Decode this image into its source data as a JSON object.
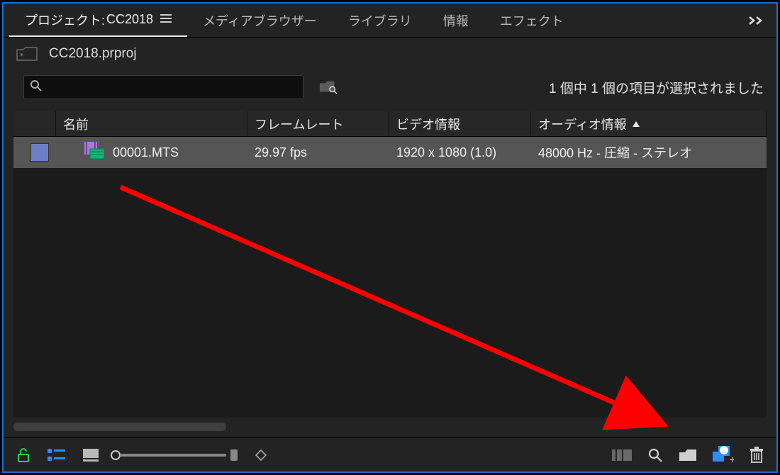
{
  "tabs": {
    "project_prefix": "プロジェクト:",
    "project_name": "CC2018",
    "media_browser": "メディアブラウザー",
    "library": "ライブラリ",
    "info": "情報",
    "effects": "エフェクト"
  },
  "project": {
    "filename": "CC2018.prproj"
  },
  "search": {
    "placeholder": ""
  },
  "status": "1 個中 1 個の項目が選択されました",
  "columns": {
    "name": "名前",
    "framerate": "フレームレート",
    "video_info": "ビデオ情報",
    "audio_info": "オーディオ情報"
  },
  "items": [
    {
      "name": "00001.MTS",
      "framerate": "29.97 fps",
      "video_info": "1920 x 1080 (1.0)",
      "audio_info": "48000 Hz - 圧縮 - ステレオ"
    }
  ],
  "colors": {
    "selection_border": "#1a6dd3",
    "arrow": "#ff0000"
  }
}
